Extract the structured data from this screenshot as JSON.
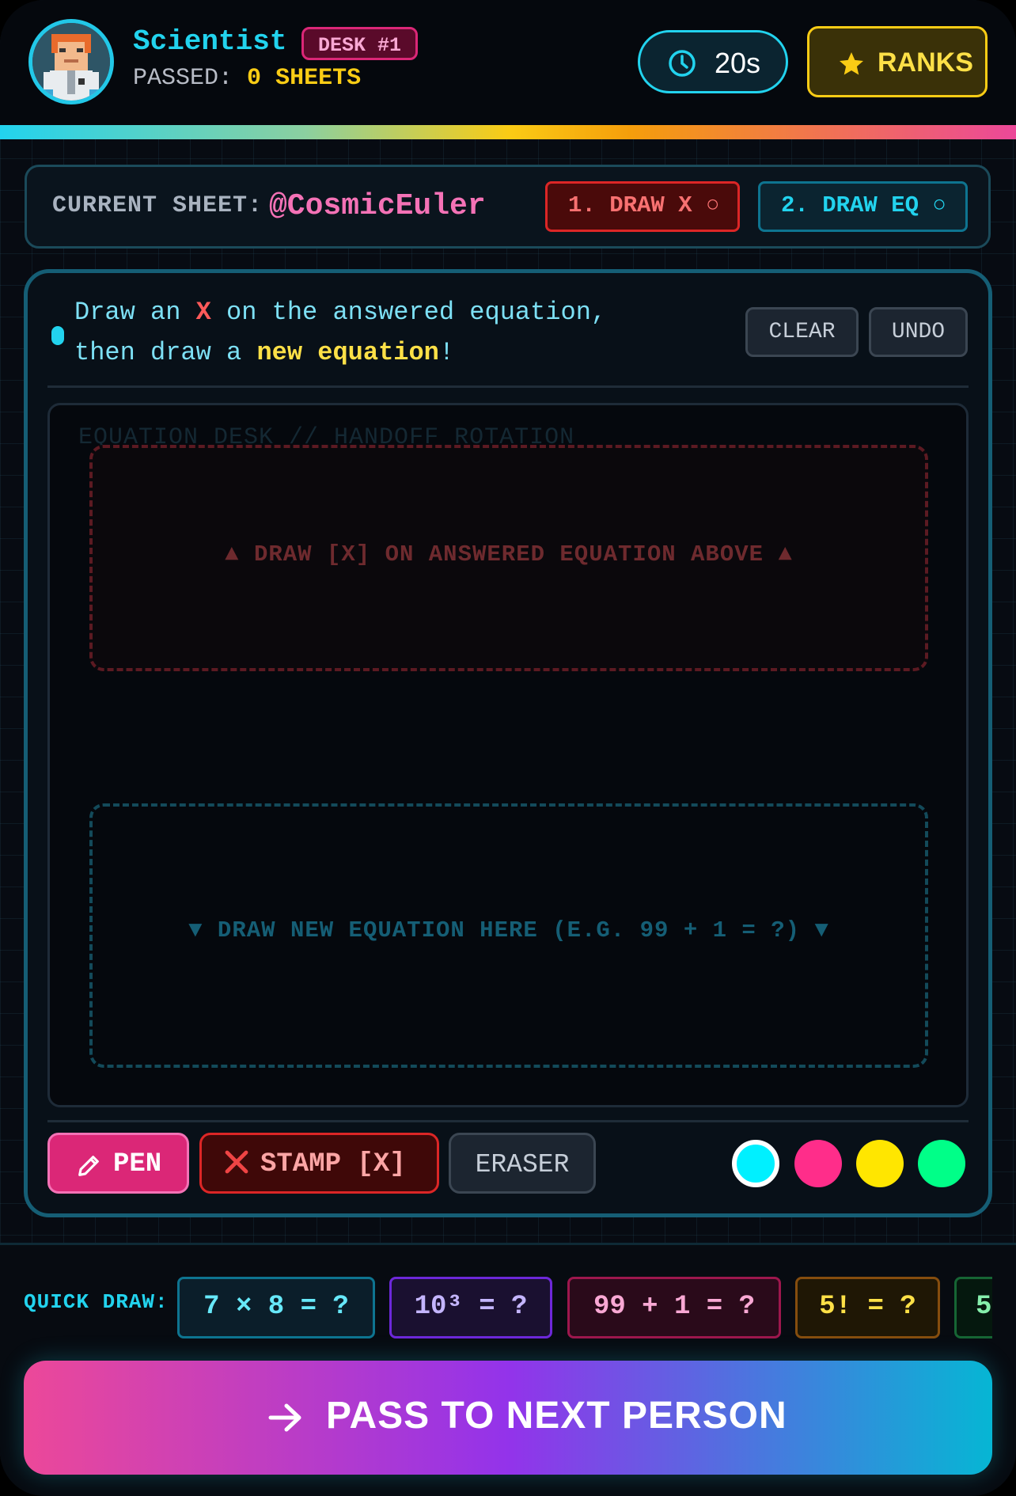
{
  "header": {
    "title": "Scientist",
    "desk_badge": "DESK #1",
    "passed_label": "PASSED:",
    "passed_count": "0",
    "passed_unit": "SHEETS",
    "timer": "20s",
    "ranks_label": "RANKS"
  },
  "sheet": {
    "label": "CURRENT SHEET:",
    "user": "@CosmicEuler",
    "step1": "1. DRAW X ○",
    "step2": "2. DRAW EQ ○"
  },
  "instructions": {
    "part1": "Draw an ",
    "x": "X",
    "part2": " on the answered equation, then draw a ",
    "new_eq": "new equation",
    "part3": "!"
  },
  "actions": {
    "clear": "CLEAR",
    "undo": "UNDO"
  },
  "canvas": {
    "label": "EQUATION DESK // HANDOFF ROTATION",
    "zone_x": "▲ DRAW [X] ON ANSWERED EQUATION ABOVE ▲",
    "zone_eq": "▼ DRAW NEW EQUATION HERE (E.G. 99 + 1 = ?) ▼"
  },
  "tools": {
    "pen": "PEN",
    "stamp": "STAMP [X]",
    "eraser": "ERASER"
  },
  "colors": {
    "cyan": "#00f0ff",
    "pink": "#ff2d8a",
    "yellow": "#ffe600",
    "green": "#00ff88",
    "accent": "#22d3ee",
    "selected": "#00f0ff"
  },
  "quick_draw": {
    "label": "QUICK DRAW:",
    "items": [
      "7 × 8 = ?",
      "10³ = ?",
      "99 + 1 = ?",
      "5! = ?",
      "5"
    ]
  },
  "pass_button": "PASS TO NEXT PERSON"
}
